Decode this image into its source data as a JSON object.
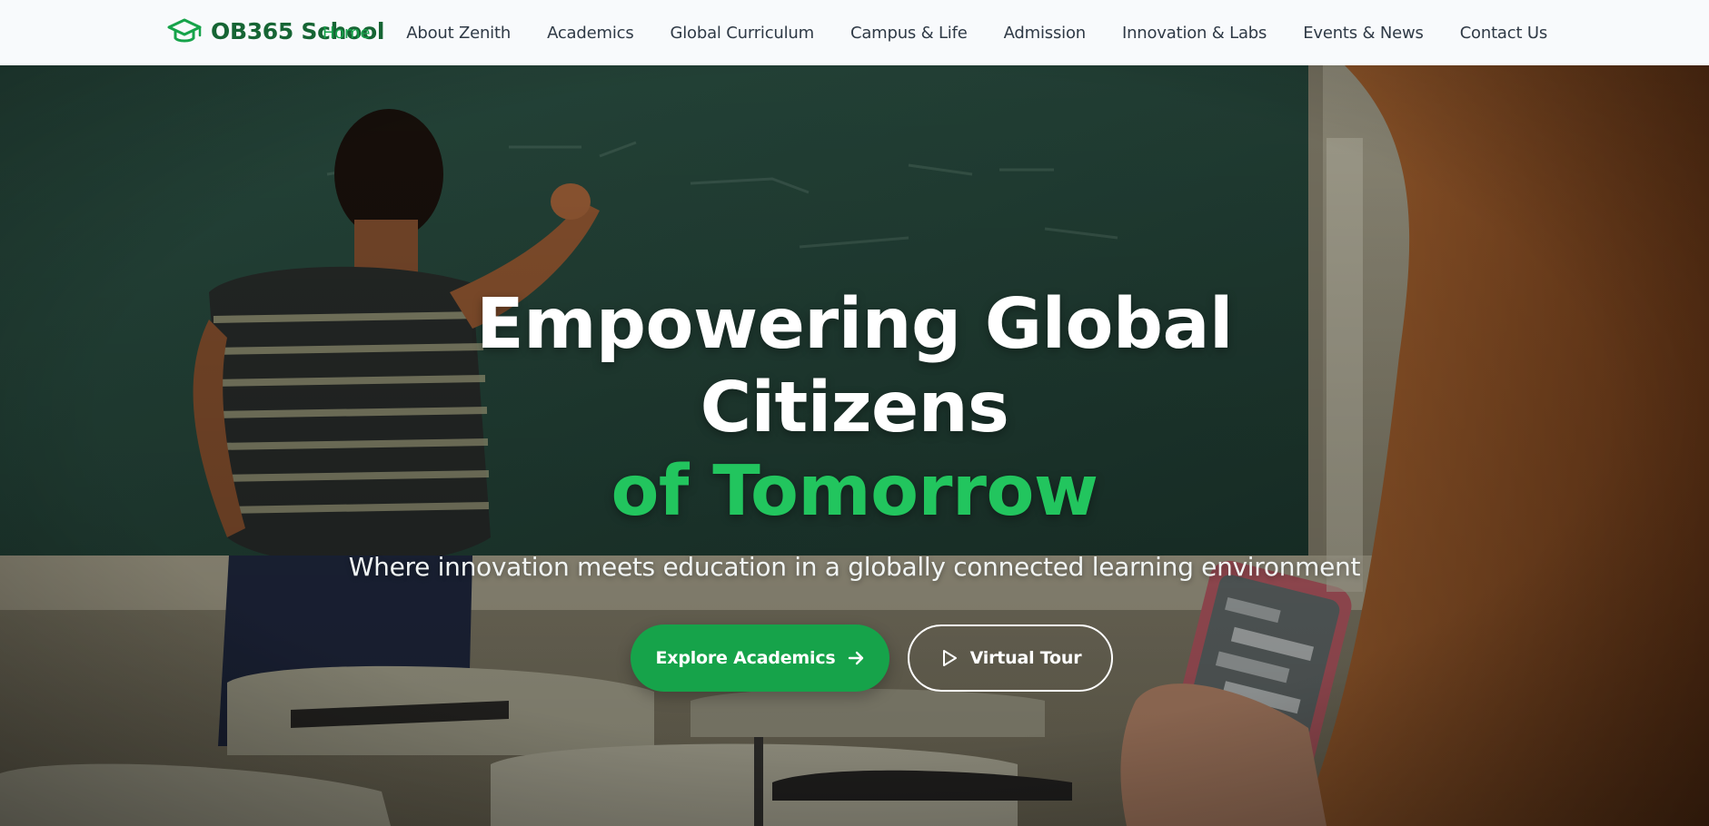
{
  "brand": {
    "name": "OB365 School",
    "icon": "graduation-cap-icon",
    "color": "#166534"
  },
  "nav": {
    "items": [
      {
        "label": "Home",
        "active": true
      },
      {
        "label": "About Zenith"
      },
      {
        "label": "Academics"
      },
      {
        "label": "Global Curriculum"
      },
      {
        "label": "Campus & Life"
      },
      {
        "label": "Admission"
      },
      {
        "label": "Innovation & Labs"
      },
      {
        "label": "Events & News"
      },
      {
        "label": "Contact Us"
      }
    ],
    "active_color": "#16a34a"
  },
  "hero": {
    "title_line1": "Empowering Global",
    "title_line2": "Citizens",
    "title_accent": "of Tomorrow",
    "subtitle": "Where innovation meets education in a globally connected learning environment",
    "primary_button": {
      "label": "Explore Academics",
      "icon": "arrow-right-icon"
    },
    "secondary_button": {
      "label": "Virtual Tour",
      "icon": "play-icon"
    },
    "accent_color": "#22c55e"
  }
}
